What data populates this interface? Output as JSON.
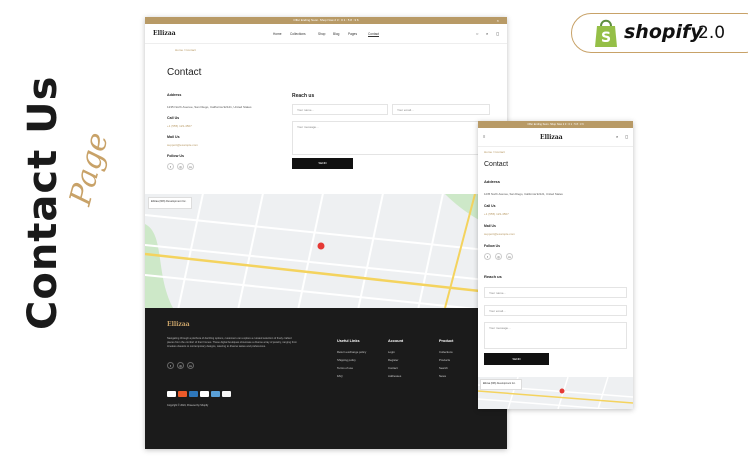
{
  "promo": {
    "title": "Contact Us",
    "subtitle": "Page"
  },
  "badge": {
    "platform": "shopify",
    "version": "2.0",
    "bag_color": "#95bf47"
  },
  "desktop": {
    "topbar": "Offer Ending Soon. Shop Now  2 3 : 0 1 : 5 8 : 3 6",
    "logo": "Ellizaa",
    "nav": [
      "Home",
      "Collections",
      "Shop",
      "Blog",
      "Pages",
      "Contact"
    ],
    "breadcrumb": "Home / Contact",
    "title": "Contact",
    "address_label": "Address",
    "address": "1235 North Avenue, San Diego, California 92121, United States",
    "call_label": "Call Us",
    "phone": "+1 (555) 123-4567",
    "mail_label": "Mail Us",
    "email": "support@example.com",
    "follow_label": "Follow Us",
    "reach_label": "Reach us",
    "name_placeholder": "Your name...",
    "email_placeholder": "Your email...",
    "message_placeholder": "Your message...",
    "send": "SEND",
    "map_card": "Ellizaa (606) Development Inc.",
    "footer": {
      "logo": "Ellizaa",
      "about": "Navigating through a plethora of dazzling options, customers can explore a curated selection of finely crafted pieces from the comfort of their homes. These digital boutiques showcase a diverse array of jewelry, ranging from timeless classics to contemporary designs, catering to diverse tastes and preferences.",
      "col1_title": "Useful Links",
      "col1": [
        "Return exchange policy",
        "Shipping policy",
        "Terms of use",
        "FAQ"
      ],
      "col2_title": "Account",
      "col2": [
        "Login",
        "Register",
        "Contact",
        "Addresses"
      ],
      "col3_title": "Product",
      "col3": [
        "Collections",
        "Products",
        "Search",
        "News"
      ],
      "copyright": "Copyright © 2024, Powered by Shopify"
    }
  },
  "mobile": {
    "topbar": "Offer Ending Soon. Shop Now  2 3 : 0 1 : 5 8 : 3 6",
    "logo": "Ellizaa",
    "breadcrumb": "Home / Contact",
    "title": "Contact",
    "address_label": "Address",
    "address": "1235 North Avenue, San Diego, California 92121, United States",
    "call_label": "Call Us",
    "phone": "+1 (555) 123-4567",
    "mail_label": "Mail Us",
    "email": "support@example.com",
    "follow_label": "Follow Us",
    "reach_label": "Reach us",
    "name_placeholder": "Your name...",
    "email_placeholder": "Your email...",
    "message_placeholder": "Your message...",
    "send": "SEND",
    "map_card": "Ellizaa (606) Development Inc."
  },
  "colors": {
    "gold": "#b89a66",
    "accent": "#c8a268",
    "footer_bg": "#1b1b1b"
  }
}
